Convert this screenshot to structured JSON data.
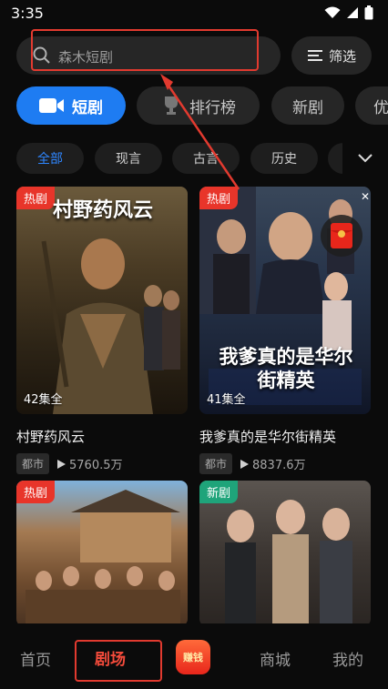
{
  "status": {
    "time": "3:35"
  },
  "search": {
    "placeholder": "森木短剧",
    "filter_label": "筛选"
  },
  "category_tabs": [
    {
      "label": "短剧",
      "active": true
    },
    {
      "label": "排行榜"
    },
    {
      "label": "新剧"
    },
    {
      "label": "优"
    }
  ],
  "sub_tabs": [
    {
      "label": "全部",
      "active": true
    },
    {
      "label": "现言"
    },
    {
      "label": "古言"
    },
    {
      "label": "历史"
    }
  ],
  "dramas": [
    {
      "title": "村野药风云",
      "poster_title": "村野药风云",
      "badge": "热剧",
      "badge_color": "#e8352a",
      "episodes": "42集全",
      "genre": "都市",
      "plays": "5760.5万"
    },
    {
      "title": "我爹真的是华尔街精英",
      "poster_title": "我爹真的是华尔街精英",
      "badge": "热剧",
      "badge_color": "#e8352a",
      "episodes": "41集全",
      "genre": "都市",
      "plays": "8837.6万"
    },
    {
      "badge": "热剧",
      "badge_color": "#e8352a"
    },
    {
      "badge": "新剧",
      "badge_color": "#1fa47a"
    }
  ],
  "bottom_nav": [
    {
      "label": "首页"
    },
    {
      "label": "剧场",
      "active": true
    },
    {
      "label": "赚钱"
    },
    {
      "label": "商城"
    },
    {
      "label": "我的"
    }
  ],
  "colors": {
    "accent": "#1e7cf2",
    "hot": "#e8352a",
    "annotation": "#e23a2f"
  }
}
